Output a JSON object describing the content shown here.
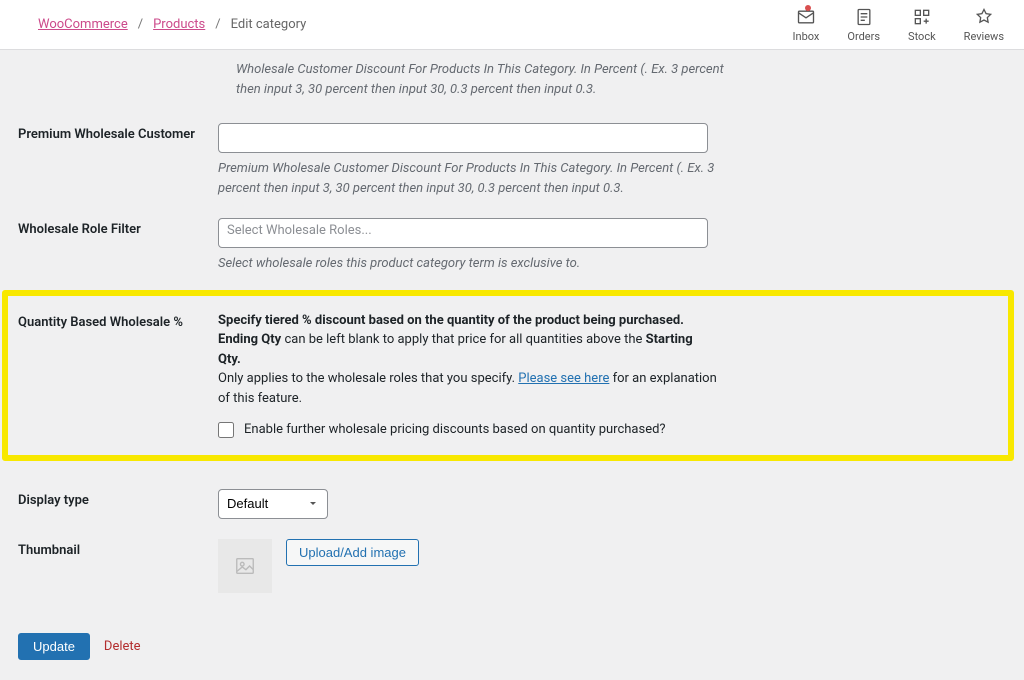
{
  "breadcrumb": {
    "root": "WooCommerce",
    "products": "Products",
    "current": "Edit category"
  },
  "activity": {
    "inbox": "Inbox",
    "orders": "Orders",
    "stock": "Stock",
    "reviews": "Reviews"
  },
  "fields": {
    "wholesale_help_top": "Wholesale Customer Discount For Products In This Category. In Percent (. Ex. 3 percent then input 3, 30 percent then input 30, 0.3 percent then input 0.3.",
    "premium_label": "Premium Wholesale Customer",
    "premium_value": "",
    "premium_help": "Premium Wholesale Customer Discount For Products In This Category. In Percent (. Ex. 3 percent then input 3, 30 percent then input 30, 0.3 percent then input 0.3.",
    "role_filter_label": "Wholesale Role Filter",
    "role_filter_placeholder": "Select Wholesale Roles...",
    "role_filter_help": "Select wholesale roles this product category term is exclusive to.",
    "qb_label": "Quantity Based Wholesale %",
    "qb_text1": "Specify tiered % discount based on the quantity of the product being purchased.",
    "qb_text2a": "Ending Qty",
    "qb_text2b": " can be left blank to apply that price for all quantities above the ",
    "qb_text2c": "Starting Qty.",
    "qb_text3a": "Only applies to the wholesale roles that you specify. ",
    "qb_link": "Please see here",
    "qb_text3b": " for an explanation of this feature.",
    "qb_checkbox_label": "Enable further wholesale pricing discounts based on quantity purchased?",
    "display_type_label": "Display type",
    "display_type_value": "Default",
    "thumbnail_label": "Thumbnail",
    "upload_btn": "Upload/Add image"
  },
  "actions": {
    "update": "Update",
    "delete": "Delete"
  }
}
